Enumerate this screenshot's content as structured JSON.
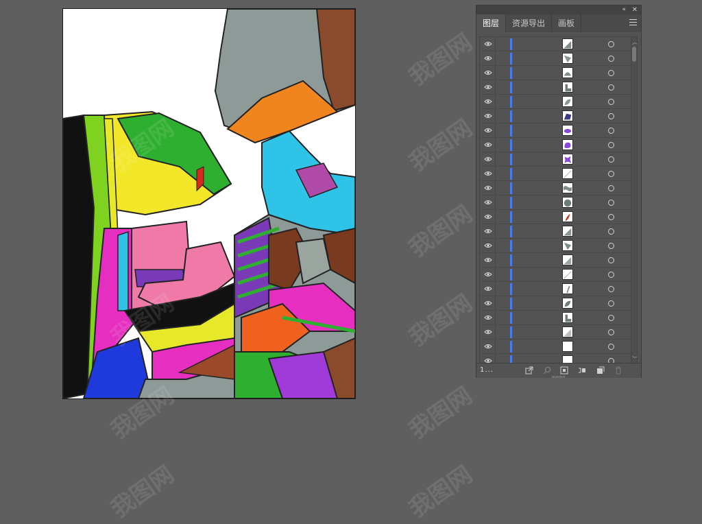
{
  "panel": {
    "tabs": [
      {
        "label": "图层",
        "active": true
      },
      {
        "label": "资源导出",
        "active": false
      },
      {
        "label": "画板",
        "active": false
      }
    ],
    "collapse_icon": "«",
    "close_icon": "✕",
    "footer_count": "1...",
    "layers": [
      {
        "shape": "tri",
        "color": "#7f8d87"
      },
      {
        "shape": "tri2",
        "color": "#8a9691"
      },
      {
        "shape": "half",
        "color": "#7f8d87"
      },
      {
        "shape": "boot",
        "color": "#6f7d77"
      },
      {
        "shape": "leaf",
        "color": "#8a9691"
      },
      {
        "shape": "gem",
        "color": "#3e3a86"
      },
      {
        "shape": "oval",
        "color": "#8a4ad8"
      },
      {
        "shape": "blob",
        "color": "#8a4ad8"
      },
      {
        "shape": "star",
        "color": "#8a4ad8"
      },
      {
        "shape": "line",
        "color": "#9aa5a0"
      },
      {
        "shape": "wave",
        "color": "#7f8d87"
      },
      {
        "shape": "circle",
        "color": "#6f7d77"
      },
      {
        "shape": "drop",
        "color": "#cc3a1e"
      },
      {
        "shape": "tri",
        "color": "#8a9691"
      },
      {
        "shape": "tri2",
        "color": "#7f8d87"
      },
      {
        "shape": "tri",
        "color": "#9aa5a0"
      },
      {
        "shape": "line",
        "color": "#9aa5a0"
      },
      {
        "shape": "slash",
        "color": "#7f8d87"
      },
      {
        "shape": "leaf",
        "color": "#6f7d77"
      },
      {
        "shape": "boot",
        "color": "#6f7d77"
      },
      {
        "shape": "tri",
        "color": "#b7c0bc"
      },
      {
        "shape": "empty",
        "color": "#ffffff"
      },
      {
        "shape": "empty",
        "color": "#ffffff"
      }
    ]
  },
  "watermark": "我图网",
  "icons": {
    "eye": "eye-icon",
    "target": "target-circle-icon",
    "footer": [
      "export-icon",
      "search-icon",
      "clip-mask-icon",
      "new-sublayer-icon",
      "new-layer-icon",
      "trash-icon"
    ]
  }
}
